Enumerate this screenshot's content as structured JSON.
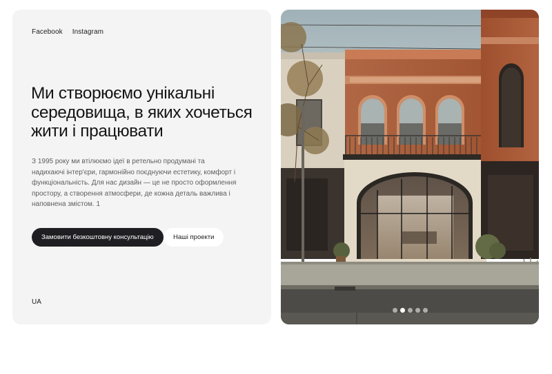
{
  "social": {
    "facebook": "Facebook",
    "instagram": "Instagram"
  },
  "hero": {
    "headline": "Ми створюємо унікальні середовища, в яких хочеться жити і працювати",
    "description": "З 1995 року ми втілюємо ідеї в ретельно продумані та надихаючі інтер'єри, гармонійно поєднуючи естетику, комфорт і функціональність. Для нас дизайн — це не просто оформлення простору, а створення атмосфери, де кожна деталь важлива і наповнена змістом. 1",
    "primary_button": "Замовити безкоштовну консультацію",
    "secondary_button": "Наші проекти"
  },
  "language": "UA",
  "gallery": {
    "image_subject": "building-facade-photo",
    "slide_count": 5,
    "active_slide": 2
  },
  "colors": {
    "card_bg": "#f4f4f4",
    "primary_button_bg": "#1f1f23",
    "brick": "#b45f3c"
  }
}
